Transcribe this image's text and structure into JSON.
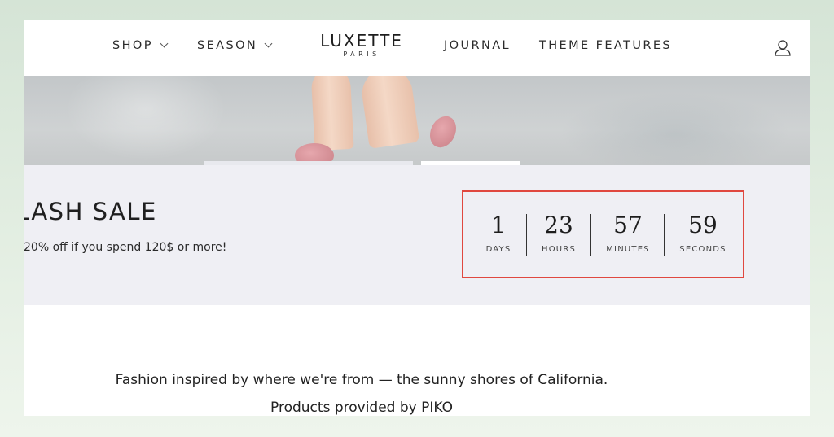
{
  "header": {
    "nav": [
      {
        "label": "SHOP",
        "has_dropdown": true
      },
      {
        "label": "SEASON",
        "has_dropdown": true
      },
      {
        "label": "JOURNAL",
        "has_dropdown": false
      },
      {
        "label": "THEME FEATURES",
        "has_dropdown": false
      }
    ],
    "logo": {
      "main": "LUXETTE",
      "sub": "PARIS"
    },
    "account_icon": "user-icon"
  },
  "hero": {
    "image": "woman-pink-heels-photo",
    "slides": 3,
    "active_slide": 2
  },
  "sale": {
    "title": "LASH SALE",
    "subtitle": "20% off if you spend 120$ or more!",
    "countdown": {
      "days": {
        "value": "1",
        "label": "DAYS"
      },
      "hours": {
        "value": "23",
        "label": "HOURS"
      },
      "minutes": {
        "value": "57",
        "label": "MINUTES"
      },
      "seconds": {
        "value": "59",
        "label": "SECONDS"
      }
    },
    "highlight_color": "#e0483f"
  },
  "about": {
    "line1": "Fashion inspired by where we're from — the sunny shores of California.",
    "line2": "Products provided by PIKO"
  }
}
